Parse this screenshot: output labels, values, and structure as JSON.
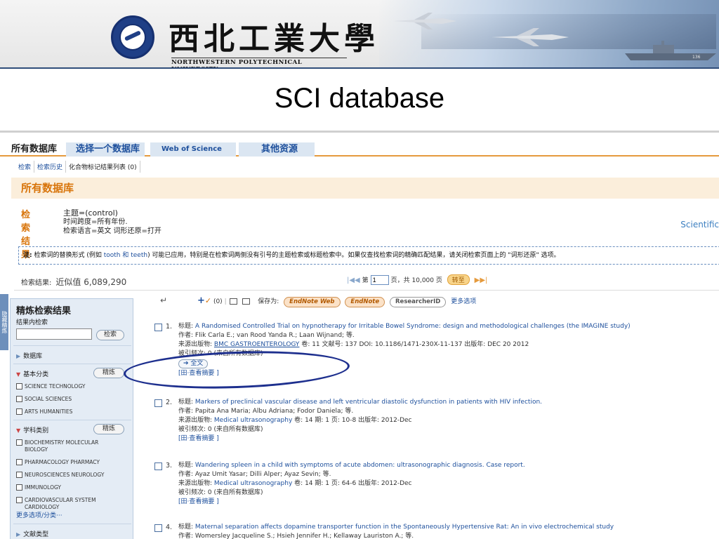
{
  "banner": {
    "univ_cn": "西北工業大學",
    "univ_en": "NORTHWESTERN POLYTECHNICAL UNIVERSITY",
    "ship_number": "136"
  },
  "slide_title": "SCI database",
  "topnav": {
    "tabs": [
      "所有数据库",
      "选择一个数据库",
      "Web of Science",
      "其他资源"
    ]
  },
  "subnav": [
    "检索",
    "检索历史",
    "化合物标记结果列表 (0)"
  ],
  "panel_title": "所有数据库",
  "result_head": {
    "label": "检索结果",
    "query": "主题=(control)",
    "timespan": "时间跨度=所有年份.",
    "language": "检索语言=英文  词形还原=打开"
  },
  "scientific_text": "Scientific",
  "note": {
    "prefix": "注:",
    "text": " 检索词的替换形式 (例如 ",
    "example": "tooth 和 teeth",
    "rest": ") 可能已应用，特别是在检索词两侧没有引号的主题检索或标题检索中。如果仅查找检索词的精确匹配结果，请关闭检索页面上的 \"词形还原\" 选项。"
  },
  "count": {
    "label": "检索结果:",
    "value": "近似值 6,089,290"
  },
  "pager": {
    "page_prefix": "第",
    "page_value": "1",
    "page_suffix": "页，共 10,000 页",
    "go_label": "转至"
  },
  "sidebar": {
    "tab_label": "隐藏精炼",
    "title": "精炼检索结果",
    "within_label": "结果内检索",
    "search_button": "检索",
    "database_label": "数据库",
    "basic_label": "基本分类",
    "refine_label": "精炼",
    "basic_items": [
      "SCIENCE TECHNOLOGY",
      "SOCIAL SCIENCES",
      "ARTS HUMANITIES"
    ],
    "subject_label": "学科类别",
    "subject_items": [
      "BIOCHEMISTRY MOLECULAR BIOLOGY",
      "PHARMACOLOGY PHARMACY",
      "NEUROSCIENCES NEUROLOGY",
      "IMMUNOLOGY",
      "CARDIOVASCULAR SYSTEM CARDIOLOGY"
    ],
    "more_options": "更多选项/分类···",
    "doctype_label": "文献类型"
  },
  "toolbar": {
    "marked_count": "(0)",
    "save_label": "保存为:",
    "endnote_web": "EndNote Web",
    "endnote": "EndNote",
    "researcherid": "ResearcherID",
    "more": "更多选项"
  },
  "records": [
    {
      "num": "1.",
      "title_label": "标题:",
      "title": "A Randomised Controlled Trial on hypnotherapy for Irritable Bowel Syndrome: design and methodological challenges (the IMAGINE study)",
      "authors_label": "作者:",
      "authors": "Flik Carla E.; van Rood Yanda R.; Laan Wijnand; 等.",
      "source_label": "来源出版物:",
      "source": "BMC GASTROENTEROLOGY",
      "details": "卷: 11   文献号: 137   DOI: 10.1186/1471-230X-11-137   出版年: DEC 20 2012",
      "cited": "被引频次: 0 (来自所有数据库)",
      "fulltext": "全文",
      "abstract": "[田·查看摘要 ]"
    },
    {
      "num": "2.",
      "title_label": "标题:",
      "title": "Markers of preclinical vascular disease and left ventricular diastolic dysfunction in patients with HIV infection.",
      "authors_label": "作者:",
      "authors": "Papita Ana Maria; Albu Adriana; Fodor Daniela; 等.",
      "source_label": "来源出版物:",
      "source": "Medical ultrasonography",
      "details": "卷: 14  期: 1  页: 10-8  出版年: 2012-Dec",
      "cited": "被引频次: 0 (来自所有数据库)",
      "abstract": "[田·查看摘要 ]"
    },
    {
      "num": "3.",
      "title_label": "标题:",
      "title": "Wandering spleen in a child with symptoms of acute abdomen: ultrasonographic diagnosis. Case report.",
      "authors_label": "作者:",
      "authors": "Ayaz Umit Yasar; Dilli Alper; Ayaz Sevin; 等.",
      "source_label": "来源出版物:",
      "source": "Medical ultrasonography",
      "details": "卷: 14  期: 1  页: 64-6  出版年: 2012-Dec",
      "cited": "被引频次: 0 (来自所有数据库)",
      "abstract": "[田·查看摘要 ]"
    },
    {
      "num": "4.",
      "title_label": "标题:",
      "title": "Maternal separation affects dopamine transporter function in the Spontaneously Hypertensive Rat: An in vivo electrochemical study",
      "authors_label": "作者:",
      "authors": "Womersley Jacqueline S.; Hsieh Jennifer H.; Kellaway Lauriston A.; 等."
    }
  ]
}
